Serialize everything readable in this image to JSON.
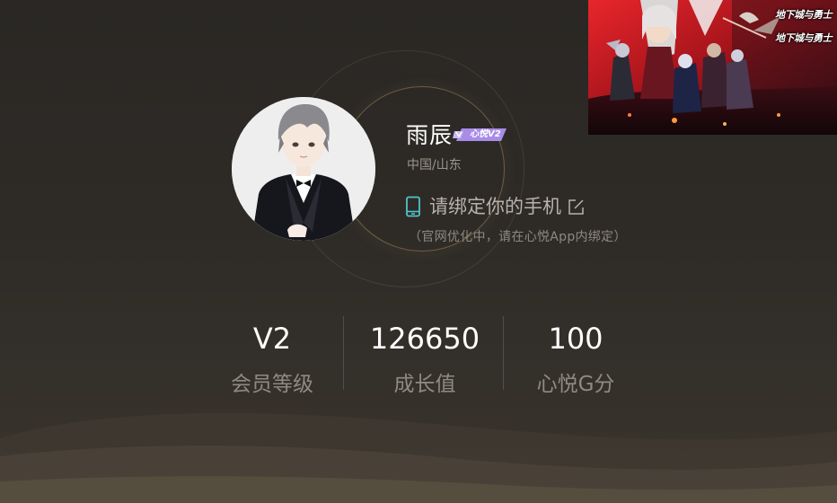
{
  "profile": {
    "username": "雨辰",
    "vip_badge": "心悦V2",
    "location": "中国/山东",
    "bind_phone_label": "请绑定你的手机",
    "bind_phone_note": "（官网优化中，请在心悦App内绑定）"
  },
  "stats": [
    {
      "value": "V2",
      "label": "会员等级"
    },
    {
      "value": "126650",
      "label": "成长值"
    },
    {
      "value": "100",
      "label": "心悦G分"
    }
  ],
  "banner": {
    "logo_text": "地下城与勇士",
    "icon": "game-artwork"
  },
  "colors": {
    "background": "#2c2925",
    "accent_teal": "#4fc3c8",
    "vip_purple": "#a98ce8",
    "ring_gold": "#c9a770",
    "text_muted": "#8f8a82"
  }
}
